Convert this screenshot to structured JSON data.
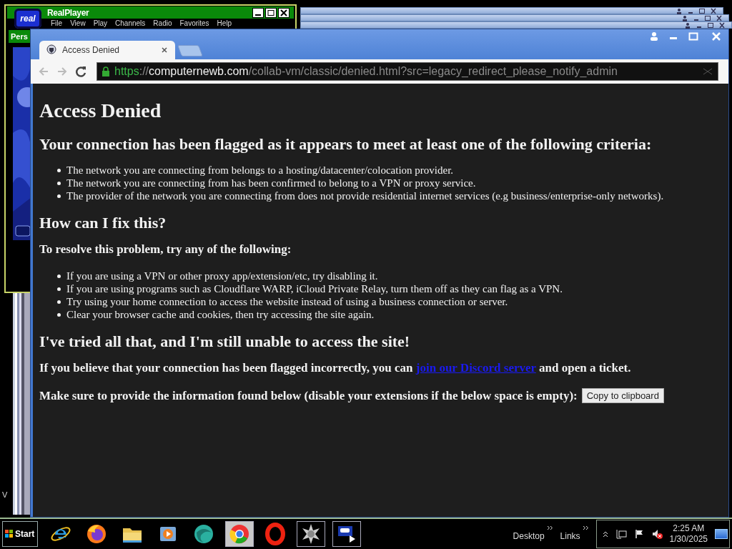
{
  "realplayer": {
    "logo": "real",
    "title": "RealPlayer",
    "menu": [
      "File",
      "View",
      "Play",
      "Channels",
      "Radio",
      "Favorites",
      "Help"
    ],
    "panel_label": "Pers"
  },
  "desktop_label": "V",
  "browser": {
    "tabs": [
      {
        "title": "Access Denied",
        "selected": true
      }
    ],
    "address": {
      "scheme": "https",
      "separator": "://",
      "host": "computernewb.com",
      "path": "/collab-vm/classic/denied.html?src=legacy_redirect_please_notify_admin"
    },
    "page": [
      {
        "kind": "h1",
        "text": "Access Denied"
      },
      {
        "kind": "h2",
        "text": "Your connection has been flagged as it appears to meet at least one of the following criteria:"
      },
      {
        "kind": "list",
        "items": [
          "The network you are connecting from belongs to a hosting/datacenter/colocation provider.",
          "The network you are connecting from has been confirmed to belong to a VPN or proxy service.",
          "The provider of the network you are connecting from does not provide residential internet services (e.g business/enterprise-only networks)."
        ]
      },
      {
        "kind": "h2",
        "text": "How can I fix this?"
      },
      {
        "kind": "p",
        "text": "To resolve this problem, try any of the following:"
      },
      {
        "kind": "list",
        "items": [
          "If you are using a VPN or other proxy app/extension/etc, try disabling it.",
          "If you are using programs such as Cloudflare WARP, iCloud Private Relay, turn them off as they can flag as a VPN.",
          "Try using your home connection to access the website instead of using a business connection or server.",
          "Clear your browser cache and cookies, then try accessing the site again."
        ]
      },
      {
        "kind": "h2",
        "text": "I've tried all that, and I'm still unable to access the site!"
      },
      {
        "kind": "link_p",
        "before": "If you believe that your connection has been flagged incorrectly, you can ",
        "link": "join our Discord server",
        "after": " and open a ticket."
      },
      {
        "kind": "button_p",
        "text": "Make sure to provide the information found below (disable your extensions if the below space is empty):",
        "button": "Copy to clipboard"
      }
    ]
  },
  "taskbar": {
    "start": "Start",
    "apps": [
      {
        "kind": "ie",
        "open": false,
        "selected": false
      },
      {
        "kind": "firefox",
        "open": false,
        "selected": false
      },
      {
        "kind": "folder",
        "open": false,
        "selected": false
      },
      {
        "kind": "media",
        "open": false,
        "selected": false
      },
      {
        "kind": "orb",
        "open": false,
        "selected": false
      },
      {
        "kind": "chrome",
        "open": true,
        "selected": true
      },
      {
        "kind": "opera",
        "open": false,
        "selected": false
      },
      {
        "kind": "gear",
        "open": true,
        "selected": false
      },
      {
        "kind": "real",
        "open": true,
        "selected": false
      }
    ],
    "toolbars": [
      "Desktop",
      "Links"
    ],
    "tray": {
      "muted": true
    },
    "clock": {
      "time": "2:25 AM",
      "date": "1/30/2025"
    }
  }
}
